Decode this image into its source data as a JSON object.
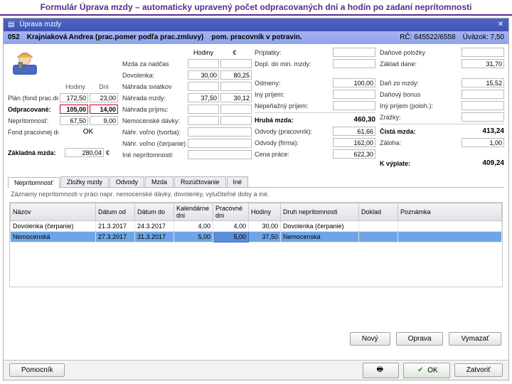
{
  "banner": "Formulár Úprava mzdy – automaticky upravený počet odpracovaných dní a hodín po zadaní neprítomnosti",
  "window": {
    "title": "Úprava mzdy"
  },
  "header": {
    "empnum": "052",
    "empname": "Krajniaková Andrea (prac.pomer podľa prac.zmluvy)",
    "empcat": "pom. pracovník v potravin.",
    "rc_label": "RČ:",
    "rc": "645522/6558",
    "uvazok_label": "Úväzok:",
    "uvazok": "7,50"
  },
  "colA": {
    "hodiny": "Hodiny",
    "dni": "Dni",
    "plan_lbl": "Plán (fond prac.doby):",
    "plan_h": "172,50",
    "plan_d": "23,00",
    "odpr_lbl": "Odpracované:",
    "odpr_h": "105,00",
    "odpr_d": "14,00",
    "nepr_lbl": "Neprítomnosť:",
    "nepr_h": "67,50",
    "nepr_d": "9,00",
    "fond_lbl": "Fond pracovnej doby:",
    "fond_val": "OK",
    "base_lbl": "Základná mzda:",
    "base_val": "280,04",
    "eur": "€"
  },
  "colB": {
    "sec_label": "Hodiny",
    "sec_val": "€",
    "mzda_nad": "Mzda za nadčas",
    "dovolenka": "Dovolenka:",
    "dov_h": "30,00",
    "dov_e": "80,25",
    "nahr_sv": "Náhrada sviatkov",
    "nahr_mz": "Náhrada mzdy:",
    "nm_h": "37,50",
    "nm_e": "30,12",
    "nahr_pr": "Náhrada príjmu:",
    "nemoc": "Nemocenské dávky:",
    "nv_tvorba": "Náhr. voľno (tvorba):",
    "nv_cerp": "Náhr. voľno (čerpanie):",
    "ine_nepr": "Iné neprítomnosti:"
  },
  "colC": {
    "priplatky": "Príplatky:",
    "dopl": "Dopl. do min. mzdy:",
    "odmeny": "Odmeny:",
    "odmeny_v": "100,00",
    "inyp": "Iný príjem:",
    "nepen": "Nepeňažný príjem:",
    "hruba_lbl": "Hrubá mzda:",
    "hruba_v": "460,30",
    "odvp_lbl": "Odvody (pracovník):",
    "odvp_v": "61,66",
    "odvf_lbl": "Odvody (firma):",
    "odvf_v": "162,00",
    "cena_lbl": "Cena práce:",
    "cena_v": "622,30"
  },
  "colD": {
    "danpol": "Daňové položky",
    "zakl_lbl": "Základ dane:",
    "zakl_v": "31,70",
    "danm_lbl": "Daň zo mzdy:",
    "danm_v": "15,52",
    "bonus": "Daňový bonus",
    "inypp": "Iný príjem (poloh.):",
    "zrazky": "Zrážky:",
    "cista_lbl": "Čistá mzda:",
    "cista_v": "413,24",
    "zaloh_lbl": "Záloha:",
    "zaloh_v": "1,00",
    "vypl_lbl": "K výplate:",
    "vypl_v": "409,24"
  },
  "tabs": [
    "Neprítomnosť",
    "Zložky mzdy",
    "Odvody",
    "Mzda",
    "Rozúčtovanie",
    "Iné"
  ],
  "desc": "Záznamy neprítomnosti v práci napr. nemocenské dávky, dovolenky, vylučiteľné doby a iné.",
  "table": {
    "cols": [
      "Názov",
      "Dátum od",
      "Dátum do",
      "Kalendárne dni",
      "Pracovné dni",
      "Hodiny",
      "Druh neprítomnosti",
      "Doklad",
      "Poznámka"
    ],
    "rows": [
      {
        "nazov": "Dovolenka (čerpanie)",
        "od": "21.3.2017",
        "do": "24.3.2017",
        "kal": "4,00",
        "prac": "4,00",
        "hod": "30,00",
        "druh": "Dovolenka (čerpanie)",
        "dokl": "",
        "pozn": ""
      },
      {
        "nazov": "Nemocenská",
        "od": "27.3.2017",
        "do": "31.3.2017",
        "kal": "5,00",
        "prac": "5,00",
        "hod": "37,50",
        "druh": "Nemocenská",
        "dokl": "",
        "pozn": ""
      }
    ]
  },
  "buttons": {
    "novy": "Nový",
    "oprava": "Oprava",
    "vymazat": "Vymazať"
  },
  "footer": {
    "pomocnik": "Pomocník",
    "ok": "OK",
    "zatvorit": "Zatvoriť"
  }
}
